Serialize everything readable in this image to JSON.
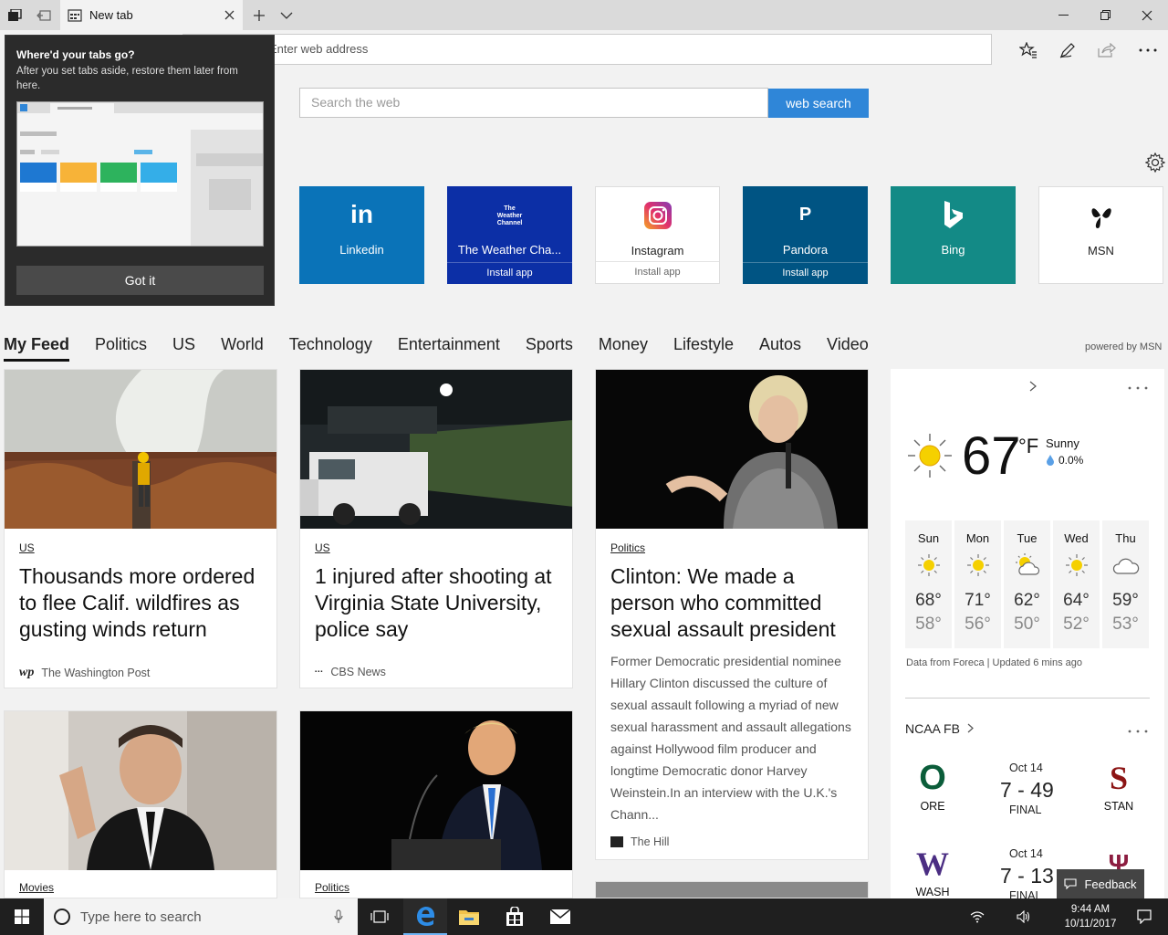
{
  "browser": {
    "tab_title": "New tab",
    "address_placeholder": "Enter web address"
  },
  "popup": {
    "title": "Where'd your tabs go?",
    "body": "After you set tabs aside, restore them later from here.",
    "button": "Got it"
  },
  "search": {
    "placeholder": "Search the web",
    "button": "web search"
  },
  "top_sites": [
    {
      "name": "Linkedin",
      "sub": "",
      "color": "#0a73b8"
    },
    {
      "name": "The Weather Cha...",
      "sub": "Install app",
      "color": "#0c2fa6"
    },
    {
      "name": "Instagram",
      "sub": "Install app",
      "color": "#ffffff"
    },
    {
      "name": "Pandora",
      "sub": "Install app",
      "color": "#005483"
    },
    {
      "name": "Bing",
      "sub": "",
      "color": "#138a86"
    },
    {
      "name": "MSN",
      "sub": "",
      "color": "#ffffff"
    }
  ],
  "weather_logo_text": [
    "The",
    "Weather",
    "Channel"
  ],
  "feed_nav": [
    "My Feed",
    "Politics",
    "US",
    "World",
    "Technology",
    "Entertainment",
    "Sports",
    "Money",
    "Lifestyle",
    "Autos",
    "Video"
  ],
  "powered_by": "powered by MSN",
  "cards": [
    {
      "category": "US",
      "headline": "Thousands more ordered to flee Calif. wildfires as gusting winds return",
      "source": "The Washington Post",
      "source_logo": "wp"
    },
    {
      "category": "US",
      "headline": "1 injured after shooting at Virginia State University, police say",
      "source": "CBS News",
      "source_logo": "▪▪▪"
    },
    {
      "category": "Politics",
      "headline": "Clinton: We made a person who committed sexual assault president",
      "summary": "Former Democratic presidential nominee Hillary Clinton discussed the culture of sexual assault following a myriad of new sexual harassment and assault allegations against Hollywood film producer and longtime Democratic donor Harvey Weinstein.In an interview with the U.K.'s Chann...",
      "source": "The Hill",
      "source_logo": "THE HILL"
    },
    {
      "category": "Movies"
    },
    {
      "category": "Politics"
    }
  ],
  "weather": {
    "temp": "67",
    "unit": "°F",
    "condition": "Sunny",
    "precip": "0.0%",
    "credit": "Data from Foreca | Updated 6 mins ago",
    "forecast": [
      {
        "day": "Sun",
        "high": "68°",
        "low": "58°",
        "icon": "sun"
      },
      {
        "day": "Mon",
        "high": "71°",
        "low": "56°",
        "icon": "sun"
      },
      {
        "day": "Tue",
        "high": "62°",
        "low": "50°",
        "icon": "partly-cloudy"
      },
      {
        "day": "Wed",
        "high": "64°",
        "low": "52°",
        "icon": "sun"
      },
      {
        "day": "Thu",
        "high": "59°",
        "low": "53°",
        "icon": "cloud"
      }
    ]
  },
  "ncaa": {
    "title": "NCAA FB",
    "games": [
      {
        "date": "Oct 14",
        "score": "7 - 49",
        "status": "FINAL",
        "home": "ORE",
        "away": "STAN",
        "home_letter": "O",
        "away_letter": "S",
        "home_color": "#0b5d3a",
        "away_color": "#8c1515"
      },
      {
        "date": "Oct 14",
        "score": "7 - 13",
        "status": "FINAL",
        "home": "WASH",
        "away": "",
        "home_letter": "W",
        "away_letter": "Ψ",
        "home_color": "#4b2e83",
        "away_color": "#8c1d40"
      }
    ]
  },
  "feedback": "Feedback",
  "taskbar": {
    "search_placeholder": "Type here to search",
    "time": "9:44 AM",
    "date": "10/11/2017"
  }
}
